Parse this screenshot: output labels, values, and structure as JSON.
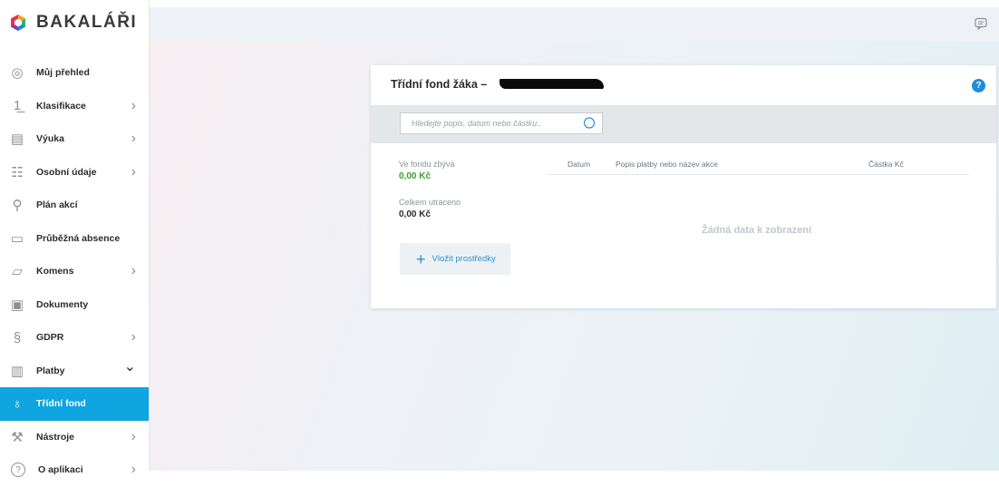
{
  "app": {
    "brand": "BAKALÁŘI"
  },
  "sidebar": {
    "items": [
      {
        "label": "Můj přehled",
        "icon": "dashboard-icon",
        "chevron": ""
      },
      {
        "label": "Klasifikace",
        "icon": "grade-icon",
        "chevron": ">"
      },
      {
        "label": "Výuka",
        "icon": "teaching-icon",
        "chevron": ">"
      },
      {
        "label": "Osobní údaje",
        "icon": "person-list-icon",
        "chevron": ">"
      },
      {
        "label": "Plán akcí",
        "icon": "plan-icon",
        "chevron": ""
      },
      {
        "label": "Průběžná absence",
        "icon": "absence-icon",
        "chevron": ""
      },
      {
        "label": "Komens",
        "icon": "message-icon",
        "chevron": ">"
      },
      {
        "label": "Dokumenty",
        "icon": "document-icon",
        "chevron": ""
      },
      {
        "label": "GDPR",
        "icon": "gdpr-icon",
        "chevron": ">"
      },
      {
        "label": "Platby",
        "icon": "payments-icon",
        "chevron": "v"
      },
      {
        "label": "Třídní fond",
        "icon": "piggy-bank-icon",
        "chevron": ""
      },
      {
        "label": "Nástroje",
        "icon": "wrench-icon",
        "chevron": ">"
      },
      {
        "label": "O aplikaci",
        "icon": "help-circle-icon",
        "chevron": ">"
      }
    ],
    "active_index": 10,
    "active_color": "#0ea5e0"
  },
  "card": {
    "title": "Třídní fond žáka –",
    "help_icon": "?",
    "search": {
      "placeholder": "Hledejte popis, datum nebo částku.."
    },
    "remaining_label": "Ve fondu zbývá",
    "remaining_value": "0,00 Kč",
    "spent_label": "Celkem utraceno",
    "spent_value": "0,00 Kč",
    "add_button": "Vložit prostředky",
    "table": {
      "columns": [
        "Datum",
        "Popis platby nebo název akce",
        "Částka Kč"
      ],
      "empty_text": "Žádná data k zobrazení"
    }
  },
  "colors": {
    "accent": "#0ea5e0",
    "positive": "#3f9b2f",
    "link": "#2c8fd6"
  }
}
